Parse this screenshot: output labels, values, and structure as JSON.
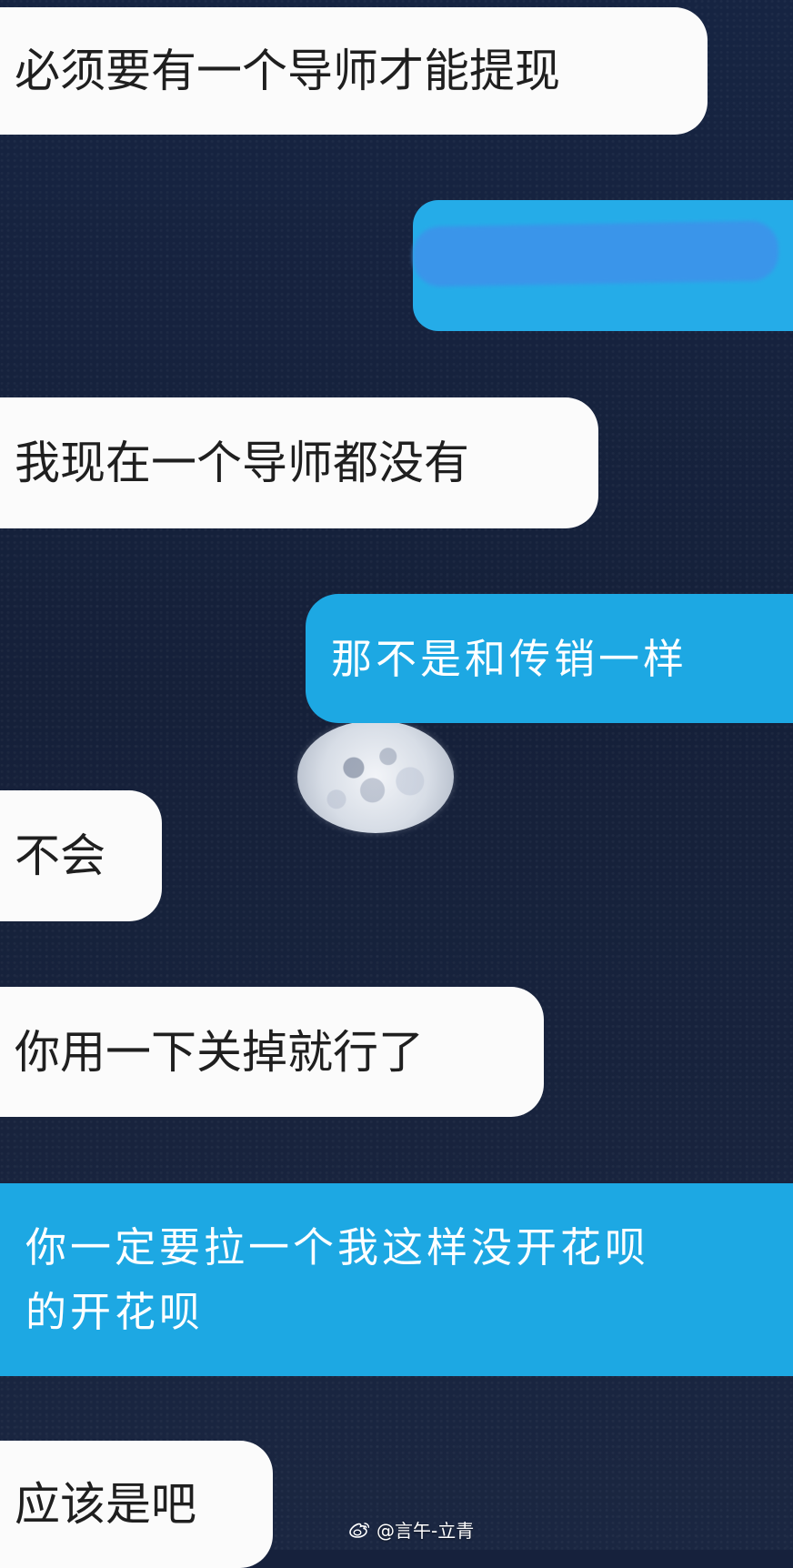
{
  "messages": [
    {
      "side": "incoming",
      "text": "必须要有一个导师才能提现"
    },
    {
      "side": "outgoing",
      "text": ""
    },
    {
      "side": "incoming",
      "text": "我现在一个导师都没有"
    },
    {
      "side": "outgoing",
      "text": "那不是和传销一样"
    },
    {
      "side": "incoming",
      "text": "不会"
    },
    {
      "side": "incoming",
      "text": "你用一下关掉就行了"
    },
    {
      "side": "outgoing",
      "lines": [
        "你一定要拉一个我这样没开花呗",
        "的开花呗"
      ]
    },
    {
      "side": "incoming",
      "text": "应该是吧"
    }
  ],
  "watermark": {
    "icon": "weibo-icon",
    "text": "@言午-立青"
  },
  "colors": {
    "background": "#16213c",
    "incoming_bubble": "#fbfbfb",
    "outgoing_bubble": "#1da8e3",
    "redaction": "#3a95ea"
  }
}
